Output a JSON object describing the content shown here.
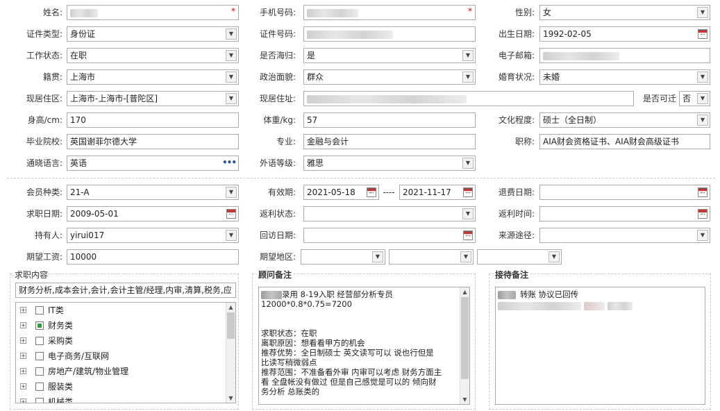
{
  "labels": {
    "name": "姓名:",
    "mobile": "手机号码:",
    "gender": "性别:",
    "idtype": "证件类型:",
    "idno": "证件号码:",
    "birth": "出生日期:",
    "workstatus": "工作状态:",
    "returnee": "是否海归:",
    "email": "电子邮箱:",
    "native": "籍贯:",
    "political": "政治面貌:",
    "marital": "婚育状况:",
    "residence": "现居住区:",
    "address": "现居住址:",
    "relocate": "是否可迁",
    "height": "身高/cm:",
    "weight": "体重/kg:",
    "education": "文化程度:",
    "school": "毕业院校:",
    "major": "专业:",
    "title": "职称:",
    "language": "通晓语言:",
    "foreign_level": "外语等级:",
    "member_type": "会员种类:",
    "valid_period": "有效期:",
    "refund_date": "退费日期:",
    "apply_date": "求职日期:",
    "rebate_status": "返利状态:",
    "rebate_time": "返利时间:",
    "holder": "持有人:",
    "revisit_date": "回访日期:",
    "source": "来源途径:",
    "salary": "期望工资:",
    "region": "期望地区:"
  },
  "values": {
    "gender": "女",
    "idtype": "身份证",
    "birth": "1992-02-05",
    "workstatus": "在职",
    "returnee": "是",
    "native": "上海市",
    "political": "群众",
    "marital": "未婚",
    "residence": "上海市-上海市-[普陀区]",
    "relocate": "否",
    "height": "170",
    "weight": "57",
    "education": "硕士（全日制）",
    "school": "英国谢菲尔德大学",
    "major": "金融与会计",
    "title": "AIA财会资格证书、AIA财会高级证书",
    "language": "英语",
    "foreign_level": "雅思",
    "member_type": "21-A",
    "valid_from": "2021-05-18",
    "valid_sep": "----",
    "valid_to": "2021-11-17",
    "apply_date": "2009-05-01",
    "holder": "yirui017",
    "salary": "10000"
  },
  "job_content": {
    "title": "求职内容",
    "summary": "财务分析,成本会计,会计,会计主管/经理,内审,清算,税务,应",
    "tree": [
      {
        "label": "IT类",
        "checked": false
      },
      {
        "label": "财务类",
        "checked": true
      },
      {
        "label": "采购类",
        "checked": false
      },
      {
        "label": "电子商务/互联网",
        "checked": false
      },
      {
        "label": "房地产/建筑/物业管理",
        "checked": false
      },
      {
        "label": "服装类",
        "checked": false
      },
      {
        "label": "机械类",
        "checked": false
      }
    ]
  },
  "consultant_notes": {
    "title": "顾问备注",
    "lines": [
      "录用  8-19入职 经营部分析专员",
      "12000*0.8*0.75=7200",
      "",
      "",
      "求职状态：在职",
      "离职原因：想看看甲方的机会",
      "推荐优势：全日制硕士  英文读写可以 说也行但是",
      "比读写稍微弱点",
      "推荐范围：不准备看外审 内审可以考虑 财务方面主",
      "看  全盘帐没有做过 但是自己感觉是可以的 倾向财",
      "务分析 总账类的"
    ]
  },
  "reception_notes": {
    "title": "接待备注",
    "line1": "转账  协议已回传"
  },
  "colors": {
    "border": "#a9a9a9",
    "required": "#dd0000",
    "checked": "#2e9a3a",
    "accent": "#2453a8"
  }
}
